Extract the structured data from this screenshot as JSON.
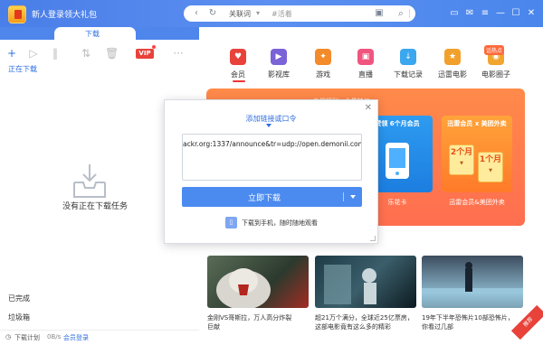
{
  "titlebar": {
    "promo_text": "新人登录领大礼包",
    "search": {
      "keyword_label": "关联词",
      "placeholder": "#活着"
    }
  },
  "left": {
    "tab_label": "下载",
    "toolbar": {
      "vip_label": "VIP"
    },
    "downloading_label": "正在下载",
    "empty_text": "没有正在下载任务",
    "completed_label": "已完成",
    "trash_label": "垃圾箱",
    "status": {
      "plan_label": "下载计划",
      "speed": "0B/s",
      "login_label": "会员登录"
    }
  },
  "categories": [
    {
      "label": "会员",
      "color": "#e8423a"
    },
    {
      "label": "影视库",
      "color": "#7a63d6"
    },
    {
      "label": "游戏",
      "color": "#f38b2b"
    },
    {
      "label": "直播",
      "color": "#f05580"
    },
    {
      "label": "下载记录",
      "color": "#3aa7ef"
    },
    {
      "label": "迅雷电影",
      "color": "#f2a02c"
    },
    {
      "label": "电影圈子",
      "color": "#f0a52e"
    }
  ],
  "hot_badge": "话热点",
  "banner": {
    "top_text": "专属福利 · 会员特权",
    "card1_title": "赞领 6个月会员",
    "card1_sub": "乐花卡",
    "card2_title": "迅雷会员 x 美团外卖",
    "card2_sub": "迅雷会员&美团外卖",
    "coupon_a": "2个月",
    "coupon_b": "1个月"
  },
  "thumbs": [
    {
      "caption": "金刚VS哥斯拉，万人高分炸裂",
      "caption2": "巨献"
    },
    {
      "caption": "超21万个满分，全球近25亿票房，",
      "caption2": "这部电影竟有这么多的精彩"
    },
    {
      "caption": "19年下半年恐怖片10部恐怖片，",
      "caption2": "你看过几部"
    },
    {
      "caption": "",
      "caption2": ""
    }
  ],
  "modal": {
    "title": "添加链接或口令",
    "input_value": "ackr.org:1337/announce&tr=udp://open.demonii.com:1337",
    "button_label": "立即下载",
    "footer_text": "下载到手机，随时随地观看"
  },
  "ribbon": "推荐"
}
